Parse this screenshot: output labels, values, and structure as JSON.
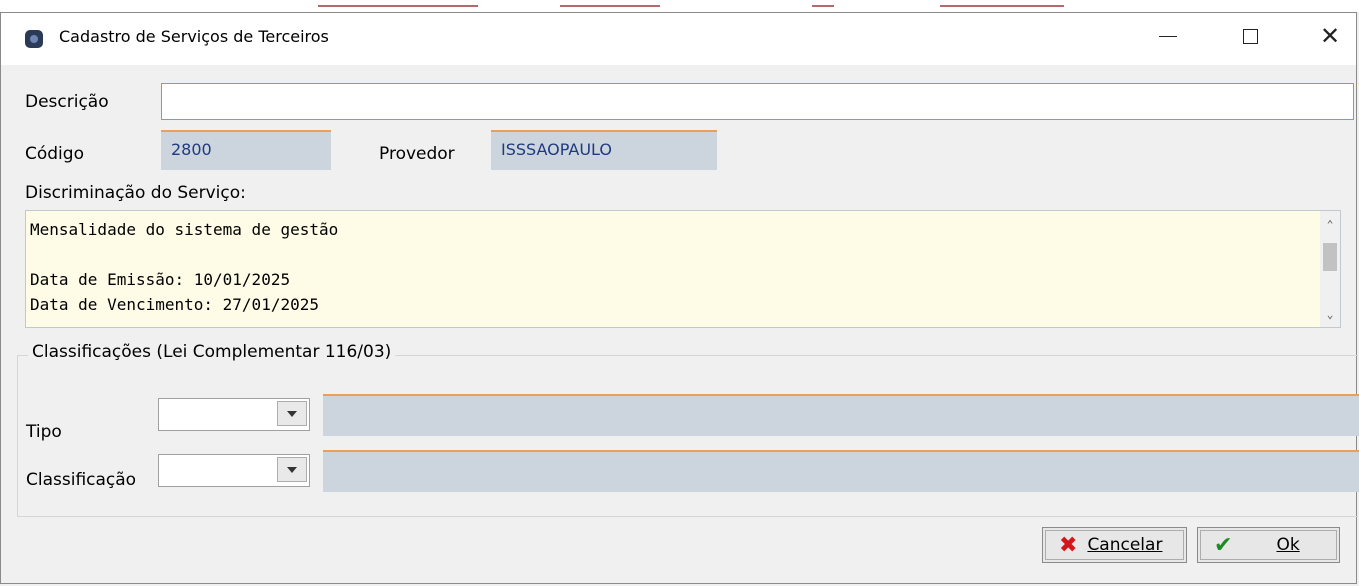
{
  "window": {
    "title": "Cadastro de Serviços de Terceiros",
    "minimize": "—",
    "close": "✕"
  },
  "form": {
    "descricao_label": "Descrição",
    "descricao_value": "",
    "codigo_label": "Código",
    "codigo_value": "2800",
    "provedor_label": "Provedor",
    "provedor_value": "ISSSAOPAULO",
    "discriminacao_label": "Discriminação do Serviço:",
    "discriminacao_lines": [
      "Mensalidade do sistema de gestão",
      "",
      "Data de Emissão: 10/01/2025",
      "Data de Vencimento: 27/01/2025"
    ]
  },
  "classificacoes": {
    "legend": "Classificações (Lei Complementar 116/03)",
    "tipo_label": "Tipo",
    "tipo_value": "",
    "classificacao_label": "Classificação",
    "classificacao_value": ""
  },
  "buttons": {
    "cancelar_label": "Cancelar",
    "cancelar_icon": "✖",
    "ok_label": "Ok",
    "ok_icon": "✔"
  },
  "colors": {
    "accent_orange": "#e8a060",
    "readonly_bg": "#ccd5dd",
    "memo_bg": "#fefce6",
    "cancel_red": "#d4161b",
    "ok_green": "#1e8a25"
  }
}
